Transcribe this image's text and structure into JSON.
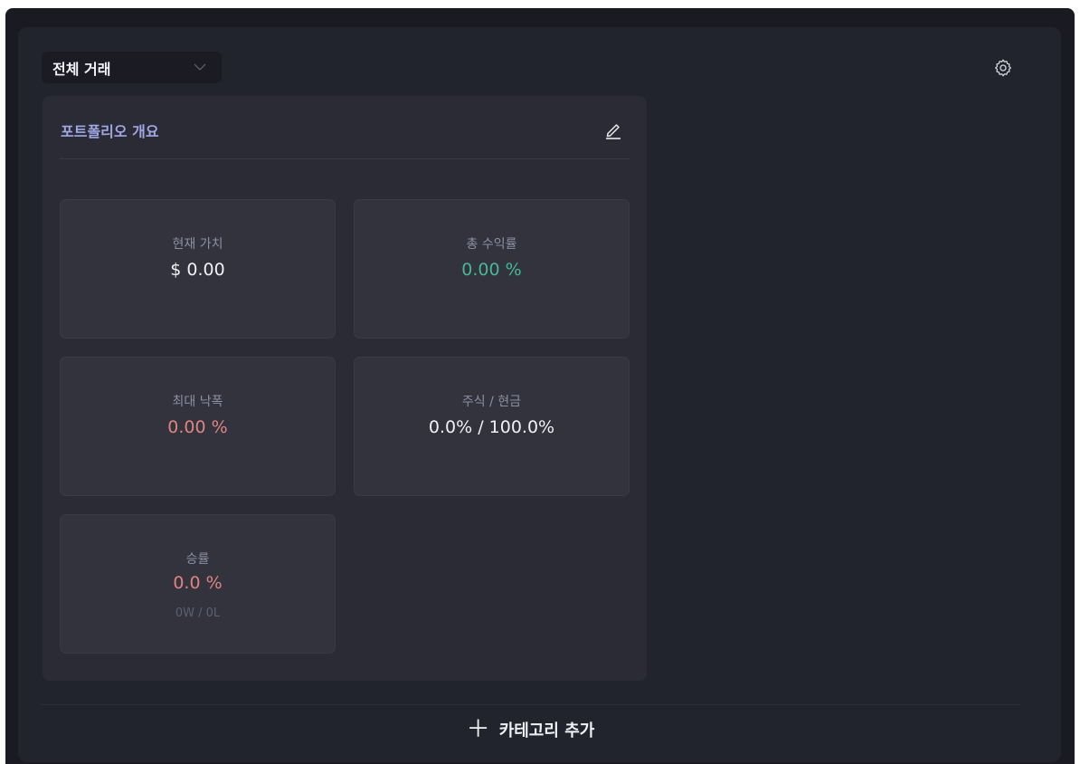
{
  "filter": {
    "selected": "전체 거래",
    "icon": "chevron-down-icon"
  },
  "settings": {
    "icon": "gear-icon"
  },
  "overview": {
    "title": "포트폴리오 개요",
    "edit_icon": "pencil-icon",
    "tiles": [
      {
        "label": "현재 가치",
        "value": "$ 0.00",
        "sub": "",
        "color": "#f0f1f5"
      },
      {
        "label": "총 수익률",
        "value": "0.00 %",
        "sub": "",
        "color": "#46b89a"
      },
      {
        "label": "최대 낙폭",
        "value": "0.00 %",
        "sub": "",
        "color": "#e0847f"
      },
      {
        "label": "주식 / 현금",
        "value": "0.0% / 100.0%",
        "sub": "",
        "color": "#f0f1f5"
      },
      {
        "label": "승률",
        "value": "0.0 %",
        "sub": "0W / 0L",
        "color": "#e0847f"
      }
    ]
  },
  "add_category": {
    "icon": "plus-icon",
    "label": "카테고리 추가"
  }
}
